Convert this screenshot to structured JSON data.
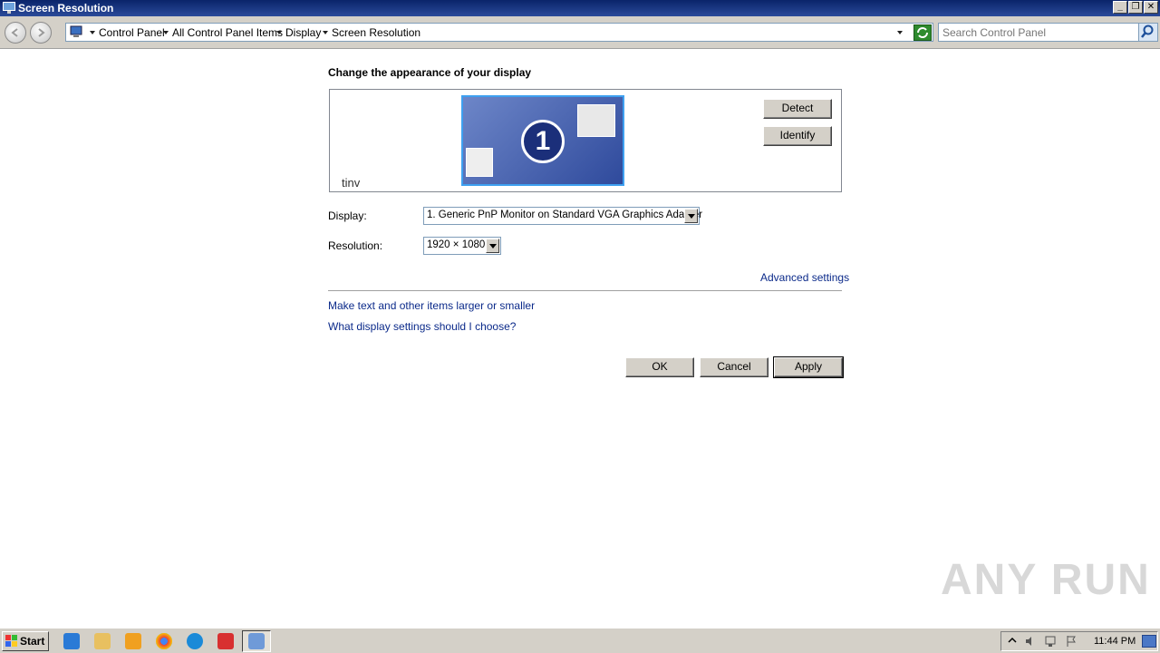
{
  "window": {
    "title": "Screen Resolution"
  },
  "addressbar": {
    "crumbs": [
      "Control Panel",
      "All Control Panel Items",
      "Display",
      "Screen Resolution"
    ],
    "search_placeholder": "Search Control Panel"
  },
  "content": {
    "heading": "Change the appearance of your display",
    "monitor_number": "1",
    "monitor_label": "tinv",
    "detect_label": "Detect",
    "identify_label": "Identify",
    "display_label": "Display:",
    "display_value": "1. Generic PnP Monitor on Standard VGA Graphics Adapter",
    "resolution_label": "Resolution:",
    "resolution_value": "1920 × 1080",
    "advanced_link": "Advanced settings",
    "link_text_size": "Make text and other items larger or smaller",
    "link_help": "What display settings should I choose?",
    "ok_label": "OK",
    "cancel_label": "Cancel",
    "apply_label": "Apply"
  },
  "watermark": "ANY RUN",
  "taskbar": {
    "start_label": "Start",
    "pinned": [
      "internet-explorer-icon",
      "folder-icon",
      "media-player-icon",
      "chrome-icon",
      "edge-icon",
      "anyrun-icon",
      "display-settings-icon"
    ],
    "clock": "11:44 PM"
  }
}
